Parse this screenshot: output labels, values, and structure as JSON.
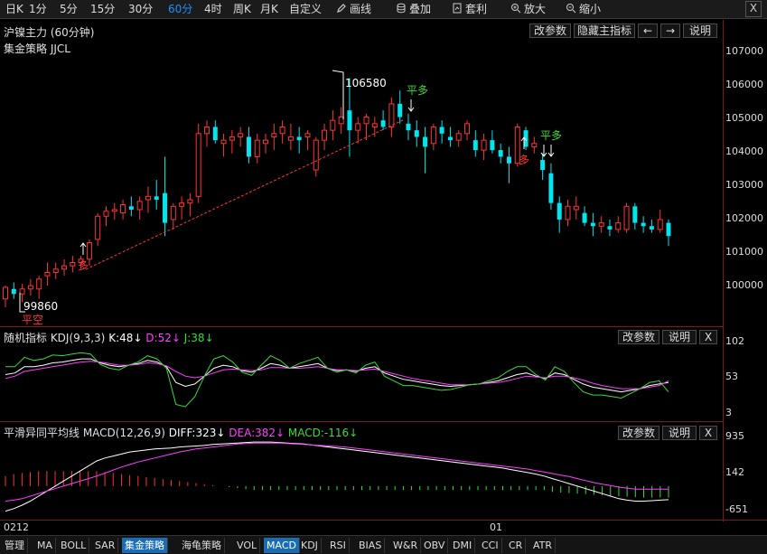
{
  "toolbar": {
    "periods": [
      "日K",
      "1分",
      "5分",
      "15分",
      "30分",
      "60分",
      "4时",
      "周K",
      "月K",
      "自定义"
    ],
    "active_period": "60分",
    "draw_label": "画线",
    "overlay_label": "叠加",
    "arbitrage_label": "套利",
    "zoom_in_label": "放大",
    "zoom_out_label": "缩小",
    "close_label": "X"
  },
  "main": {
    "title": "沪镍主力 (60分钟)",
    "subtitle": "集金策略 JJCL",
    "buttons": {
      "params": "改参数",
      "hide_main": "隐藏主指标",
      "left": "←",
      "right": "→",
      "help": "说明"
    },
    "y_labels": [
      "107000",
      "106000",
      "105000",
      "104000",
      "103000",
      "102000",
      "101000",
      "100000"
    ],
    "annotations": {
      "high": "106580",
      "low": "99860",
      "signals": [
        "平空",
        "多",
        "平多",
        "多",
        "平多"
      ]
    }
  },
  "kdj": {
    "title_prefix": "随机指标 KDJ(9,3,3)",
    "k_text": "K:48↓",
    "d_text": "D:52↓",
    "j_text": "J:38↓",
    "y_labels": [
      "102",
      "53",
      "3"
    ],
    "buttons": {
      "params": "改参数",
      "help": "说明",
      "close": "X"
    }
  },
  "macd": {
    "title_prefix": "平滑异同平均线 MACD(12,26,9)",
    "diff_text": "DIFF:323↓",
    "dea_text": "DEA:382↓",
    "macd_text": "MACD:-116↓",
    "y_labels": [
      "935",
      "142",
      "-651"
    ],
    "buttons": {
      "params": "改参数",
      "help": "说明",
      "close": "X"
    }
  },
  "time_axis": [
    "0212",
    "01"
  ],
  "bottom_tabs": [
    "管理",
    "MA",
    "BOLL",
    "SAR",
    "集金策略",
    "海龟策略",
    "VOL",
    "MACD",
    "KDJ",
    "RSI",
    "BIAS",
    "W&R",
    "OBV",
    "DMI",
    "CCI",
    "CR",
    "ATR"
  ],
  "active_tabs": [
    "集金策略",
    "MACD"
  ],
  "colors": {
    "up": "#ff3333",
    "down": "#00e5ee",
    "k_line": "#ffffff",
    "d_line": "#ff3cff",
    "j_line": "#33dd33",
    "accent_tab": "#1a6db5"
  },
  "chart_data": [
    {
      "type": "candlestick",
      "title": "沪镍主力 (60分钟)",
      "ylim": [
        99100,
        107300
      ],
      "candles": [
        [
          99900,
          100300,
          99650,
          100250
        ],
        [
          100200,
          100400,
          99900,
          100050
        ],
        [
          100050,
          100350,
          99800,
          100200
        ],
        [
          100200,
          100500,
          100000,
          100300
        ],
        [
          100200,
          100600,
          99900,
          100500
        ],
        [
          100600,
          101000,
          100300,
          100700
        ],
        [
          100700,
          101000,
          100500,
          100800
        ],
        [
          100800,
          101100,
          100600,
          100900
        ],
        [
          100900,
          101200,
          100700,
          101000
        ],
        [
          101000,
          101200,
          100800,
          101100
        ],
        [
          101100,
          101700,
          100900,
          101600
        ],
        [
          101700,
          102500,
          101500,
          102400
        ],
        [
          102400,
          102700,
          102100,
          102550
        ],
        [
          102550,
          102800,
          102300,
          102600
        ],
        [
          102500,
          102900,
          102300,
          102750
        ],
        [
          102700,
          103000,
          102400,
          102600
        ],
        [
          102600,
          103000,
          102300,
          102850
        ],
        [
          102900,
          103300,
          102500,
          103000
        ],
        [
          103000,
          103500,
          102600,
          102900
        ],
        [
          103100,
          104200,
          101800,
          102200
        ],
        [
          102300,
          102800,
          102000,
          102700
        ],
        [
          102700,
          103000,
          102300,
          102800
        ],
        [
          102800,
          103100,
          102400,
          102900
        ],
        [
          103000,
          105200,
          102800,
          104900
        ],
        [
          104900,
          105300,
          104500,
          105100
        ],
        [
          105100,
          105300,
          104600,
          104700
        ],
        [
          104600,
          104900,
          104200,
          104700
        ],
        [
          104700,
          105000,
          104300,
          104800
        ],
        [
          104800,
          105100,
          104500,
          104900
        ],
        [
          104800,
          105100,
          104000,
          104200
        ],
        [
          104200,
          104900,
          104000,
          104700
        ],
        [
          104600,
          104900,
          104300,
          104700
        ],
        [
          104800,
          105200,
          104400,
          104900
        ],
        [
          104900,
          105300,
          104600,
          105100
        ],
        [
          104700,
          105200,
          104400,
          104800
        ],
        [
          104800,
          105100,
          104300,
          104700
        ],
        [
          104800,
          105000,
          104400,
          104900
        ],
        [
          103800,
          104800,
          103600,
          104700
        ],
        [
          104700,
          105200,
          104400,
          105000
        ],
        [
          105000,
          105600,
          104700,
          105300
        ],
        [
          105200,
          105700,
          104900,
          105400
        ],
        [
          105600,
          106580,
          104200,
          105000
        ],
        [
          105000,
          105400,
          104600,
          105200
        ],
        [
          105200,
          105500,
          104700,
          105400
        ],
        [
          105100,
          105400,
          104800,
          105200
        ],
        [
          105300,
          105600,
          105000,
          105100
        ],
        [
          105100,
          106000,
          104800,
          105800
        ],
        [
          105800,
          106200,
          105200,
          105400
        ],
        [
          105200,
          105500,
          104700,
          105000
        ],
        [
          105000,
          105300,
          104500,
          104800
        ],
        [
          104800,
          105100,
          103700,
          104500
        ],
        [
          104600,
          105200,
          104400,
          105100
        ],
        [
          105100,
          105300,
          104600,
          104900
        ],
        [
          104800,
          105100,
          104500,
          104700
        ],
        [
          104700,
          105000,
          104500,
          104900
        ],
        [
          104900,
          105300,
          104700,
          105200
        ],
        [
          104700,
          105000,
          104200,
          104400
        ],
        [
          104400,
          104900,
          104100,
          104700
        ],
        [
          104700,
          105000,
          104300,
          104400
        ],
        [
          104400,
          104600,
          104000,
          104200
        ],
        [
          104200,
          104500,
          103400,
          104000
        ],
        [
          104000,
          105200,
          103900,
          105100
        ],
        [
          105000,
          105100,
          104400,
          104500
        ],
        [
          104500,
          104800,
          104300,
          104600
        ],
        [
          104100,
          104300,
          103500,
          103800
        ],
        [
          103700,
          104000,
          102600,
          102800
        ],
        [
          102800,
          103000,
          101900,
          102300
        ],
        [
          102300,
          102900,
          102100,
          102700
        ],
        [
          102600,
          103000,
          102300,
          102700
        ],
        [
          102500,
          102700,
          102100,
          102200
        ],
        [
          102200,
          102500,
          101800,
          102100
        ],
        [
          102100,
          102400,
          101900,
          102200
        ],
        [
          102100,
          102300,
          101800,
          102000
        ],
        [
          102000,
          102400,
          101900,
          102200
        ],
        [
          102000,
          102800,
          101900,
          102700
        ],
        [
          102700,
          102800,
          102000,
          102200
        ],
        [
          102200,
          102400,
          101900,
          102100
        ],
        [
          102100,
          102300,
          101900,
          102000
        ],
        [
          102000,
          102600,
          101900,
          102300
        ],
        [
          102200,
          102300,
          101500,
          101800
        ]
      ]
    },
    {
      "type": "line",
      "title": "随机指标 KDJ(9,3,3)",
      "ylim": [
        3,
        102
      ],
      "series": [
        {
          "name": "K",
          "values": [
            60,
            62,
            70,
            70,
            72,
            75,
            76,
            78,
            80,
            80,
            75,
            72,
            70,
            72,
            74,
            78,
            76,
            70,
            50,
            45,
            48,
            58,
            68,
            72,
            70,
            65,
            63,
            68,
            74,
            72,
            68,
            70,
            72,
            74,
            68,
            65,
            66,
            64,
            68,
            70,
            62,
            58,
            54,
            52,
            50,
            48,
            46,
            45,
            46,
            47,
            48,
            50,
            52,
            56,
            60,
            62,
            58,
            55,
            62,
            60,
            54,
            48,
            44,
            42,
            40,
            38,
            40,
            42,
            46,
            48,
            50
          ]
        },
        {
          "name": "D",
          "values": [
            55,
            58,
            64,
            66,
            68,
            70,
            72,
            74,
            76,
            77,
            76,
            74,
            72,
            72,
            73,
            75,
            74,
            71,
            64,
            58,
            56,
            58,
            62,
            66,
            67,
            66,
            65,
            66,
            69,
            69,
            68,
            68,
            69,
            70,
            68,
            66,
            66,
            65,
            66,
            67,
            64,
            61,
            58,
            55,
            53,
            51,
            49,
            47,
            47,
            47,
            48,
            49,
            50,
            52,
            55,
            58,
            57,
            56,
            58,
            58,
            56,
            53,
            49,
            46,
            44,
            42,
            42,
            42,
            44,
            46,
            52
          ]
        },
        {
          "name": "J",
          "values": [
            70,
            70,
            82,
            78,
            80,
            85,
            84,
            86,
            88,
            86,
            73,
            68,
            66,
            72,
            76,
            84,
            80,
            68,
            22,
            19,
            32,
            58,
            80,
            84,
            76,
            63,
            59,
            72,
            84,
            78,
            68,
            74,
            78,
            82,
            68,
            63,
            66,
            62,
            72,
            76,
            58,
            52,
            46,
            46,
            44,
            42,
            40,
            41,
            44,
            47,
            48,
            52,
            56,
            64,
            70,
            70,
            60,
            53,
            70,
            64,
            50,
            38,
            34,
            34,
            32,
            30,
            36,
            42,
            50,
            52,
            38
          ]
        }
      ]
    },
    {
      "type": "bar",
      "title": "平滑异同平均线 MACD(12,26,9)",
      "ylim": [
        -651,
        935
      ],
      "series": [
        {
          "name": "DIFF",
          "values": [
            -500,
            -450,
            -380,
            -300,
            -200,
            -100,
            0,
            100,
            200,
            300,
            400,
            500,
            560,
            600,
            640,
            680,
            700,
            720,
            740,
            750,
            760,
            780,
            790,
            800,
            810,
            830,
            840,
            850,
            860,
            870,
            880,
            880,
            880,
            870,
            860,
            850,
            840,
            820,
            800,
            780,
            760,
            740,
            720,
            700,
            680,
            660,
            640,
            620,
            600,
            580,
            560,
            540,
            520,
            500,
            480,
            460,
            440,
            420,
            400,
            380,
            360,
            330,
            300,
            270,
            240,
            200,
            150,
            100,
            50,
            0,
            -50,
            -100,
            -150,
            -200,
            -250,
            -280,
            -300,
            -300,
            -290,
            -280,
            -270
          ]
        },
        {
          "name": "DEA",
          "values": [
            -300,
            -280,
            -250,
            -200,
            -150,
            -100,
            -50,
            0,
            50,
            100,
            150,
            200,
            260,
            320,
            380,
            430,
            480,
            520,
            560,
            600,
            640,
            680,
            710,
            740,
            760,
            780,
            800,
            820,
            840,
            850,
            860,
            860,
            860,
            860,
            850,
            840,
            830,
            820,
            810,
            800,
            790,
            780,
            760,
            740,
            720,
            700,
            680,
            660,
            640,
            620,
            600,
            580,
            560,
            540,
            520,
            500,
            480,
            460,
            440,
            420,
            400,
            380,
            360,
            340,
            310,
            280,
            250,
            220,
            190,
            150,
            110,
            70,
            40,
            10,
            -20,
            -40,
            -60,
            -60,
            -60,
            -60,
            -60
          ]
        },
        {
          "name": "MACD",
          "values": [
            200,
            240,
            260,
            280,
            300,
            300,
            300,
            300,
            300,
            300,
            300,
            300,
            280,
            260,
            240,
            220,
            200,
            180,
            160,
            140,
            120,
            100,
            80,
            60,
            40,
            20,
            0,
            -20,
            -40,
            -60,
            -80,
            -80,
            -80,
            -80,
            -80,
            -80,
            -80,
            -80,
            -80,
            -80,
            -80,
            -80,
            -80,
            -80,
            -80,
            -80,
            -80,
            -80,
            -80,
            -80,
            -80,
            -80,
            -80,
            -80,
            -80,
            -80,
            -80,
            -80,
            -80,
            -80,
            -80,
            -80,
            -80,
            -80,
            -80,
            -80,
            -116,
            -130,
            -140,
            -150,
            -160,
            -170,
            -180,
            -190,
            -200,
            -210,
            -220,
            -230,
            -230,
            -230,
            -230
          ]
        }
      ]
    }
  ]
}
